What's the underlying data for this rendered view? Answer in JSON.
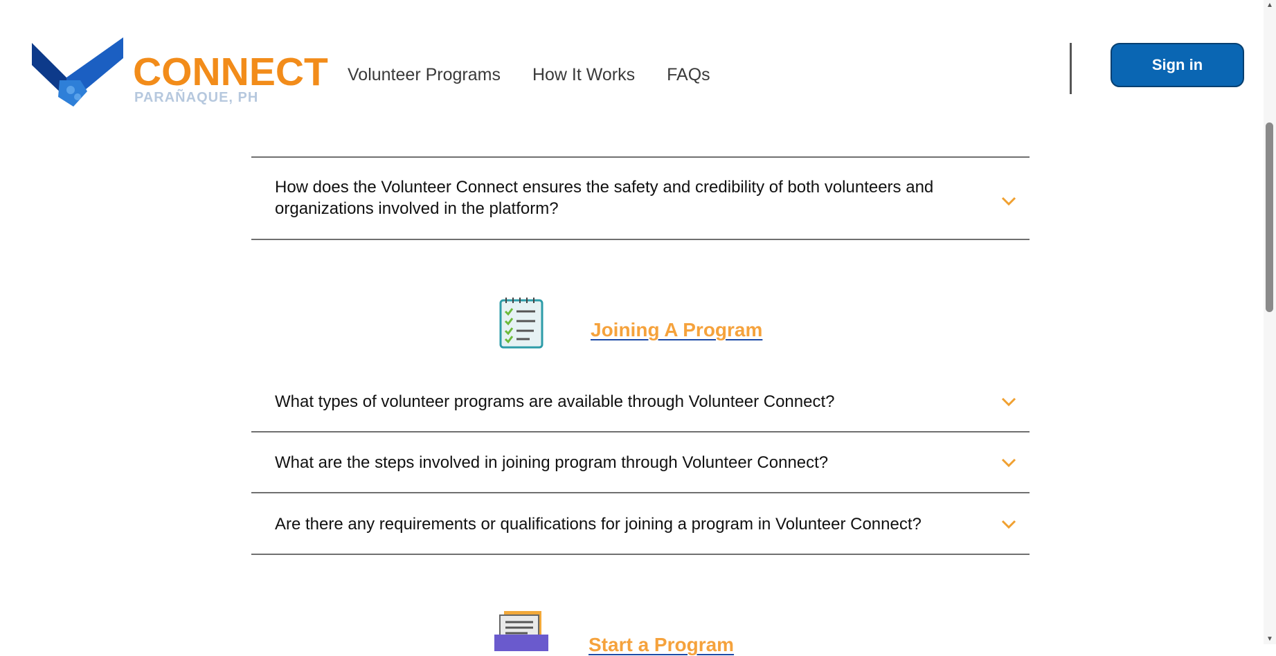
{
  "header": {
    "logo_word": "CONNECT",
    "logo_sub": "PARAÑAQUE, PH",
    "nav": [
      "Volunteer Programs",
      "How It Works",
      "FAQs"
    ],
    "signin_label": "Sign in"
  },
  "faqs": {
    "first_question": "How does the Volunteer Connect ensures the safety and credibility of both volunteers and organizations involved in the platform?",
    "joining_title": "Joining A Program",
    "joining_questions": [
      "What types of volunteer programs are available through Volunteer Connect?",
      "What are the steps involved in joining program through Volunteer Connect?",
      "Are there any requirements or qualifications for joining a program in Volunteer Connect?"
    ],
    "start_title": "Start a Program"
  },
  "colors": {
    "accent": "#f28c1a",
    "primary": "#0a66b3",
    "chevron": "#f0a030"
  },
  "icons": [
    "handshake-logo-icon",
    "checklist-icon",
    "chevron-down-icon",
    "folder-icon"
  ]
}
